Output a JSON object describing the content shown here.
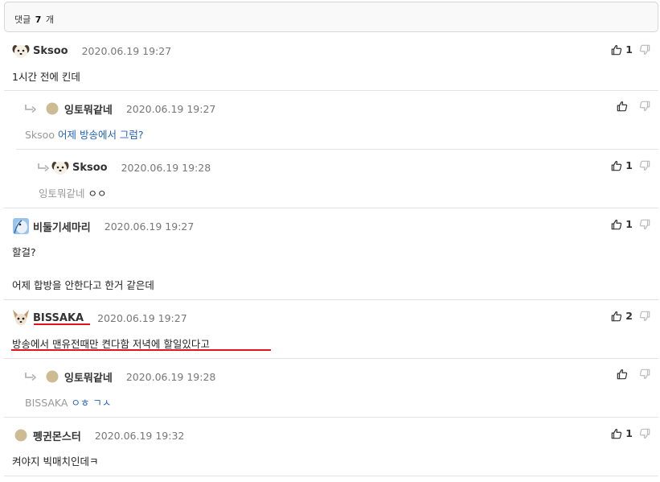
{
  "header": {
    "label": "댓글",
    "count": "7",
    "unit": "개"
  },
  "comments": [
    {
      "author": "Sksoo",
      "date": "2020.06.19 19:27",
      "text": "1시간 전에 킨데",
      "likes": "1",
      "avatar": "dog-white"
    },
    {
      "author": "잉토뭐같네",
      "date": "2020.06.19 19:27",
      "mention": "Sksoo",
      "text": "어제 방송에서 그럼?",
      "likes": "",
      "avatar": "circle-tan"
    },
    {
      "author": "Sksoo",
      "date": "2020.06.19 19:28",
      "mention": "잉토뭐같네",
      "text": "ㅇㅇ",
      "likes": "1",
      "avatar": "dog-white"
    },
    {
      "author": "비둘기세마리",
      "date": "2020.06.19 19:27",
      "text1": "할걸?",
      "text2": "어제 합방을 안한다고 한거 같은데",
      "likes": "1",
      "avatar": "pigeon-blue"
    },
    {
      "author": "BISSAKA",
      "date": "2020.06.19 19:27",
      "text": "방송에서 맨유전때만 켠다함 저녁에 할일있다고",
      "likes": "2",
      "avatar": "dog-chihuahua"
    },
    {
      "author": "잉토뭐같네",
      "date": "2020.06.19 19:28",
      "mention": "BISSAKA",
      "text": "ㅇㅎ ㄱㅅ",
      "likes": "",
      "avatar": "circle-tan"
    },
    {
      "author": "펭귄몬스터",
      "date": "2020.06.19 19:32",
      "text": "켜야지 빅매치인데ㅋ",
      "likes": "1",
      "avatar": "circle-tan"
    }
  ],
  "colors": {
    "link": "#2463b9",
    "highlight": "#e0151b",
    "divider": "#e3e3e3",
    "muted": "#999999"
  }
}
